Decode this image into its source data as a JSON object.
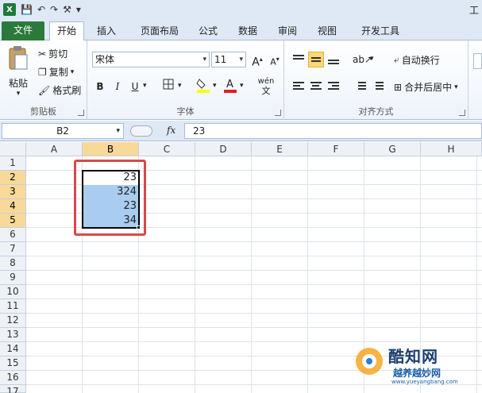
{
  "qat": {
    "app_icon": "X",
    "save": "💾",
    "undo": "↶",
    "redo": "↷",
    "tools": "⚒",
    "customize": "▾",
    "right_text": "工"
  },
  "tabs": [
    {
      "label": "文件",
      "kind": "file"
    },
    {
      "label": "开始",
      "kind": "active"
    },
    {
      "label": "插入",
      "kind": ""
    },
    {
      "label": "页面布局",
      "kind": ""
    },
    {
      "label": "公式",
      "kind": ""
    },
    {
      "label": "数据",
      "kind": ""
    },
    {
      "label": "审阅",
      "kind": ""
    },
    {
      "label": "视图",
      "kind": ""
    },
    {
      "label": "开发工具",
      "kind": ""
    }
  ],
  "clipboard": {
    "group_label": "剪贴板",
    "paste": "粘贴",
    "cut": "剪切",
    "copy": "复制",
    "format_painter": "格式刷"
  },
  "font": {
    "group_label": "字体",
    "font_name": "宋体",
    "font_size": "11",
    "grow": "A",
    "shrink": "A",
    "bold": "B",
    "italic": "I",
    "underline": "U",
    "wen": "wén"
  },
  "alignment": {
    "group_label": "对齐方式",
    "wrap_text": "自动换行",
    "merge_center": "合并后居中"
  },
  "formula_bar": {
    "name_box": "B2",
    "fx": "fx",
    "value": "23"
  },
  "columns": [
    "A",
    "B",
    "C",
    "D",
    "E",
    "F",
    "G",
    "H"
  ],
  "rows": [
    "1",
    "2",
    "3",
    "4",
    "5",
    "6",
    "7",
    "8",
    "9",
    "10",
    "11",
    "12",
    "13",
    "14",
    "15",
    "16",
    "17"
  ],
  "cells": {
    "B2": "23",
    "B3": "324",
    "B4": "23",
    "B5": "34"
  },
  "watermark": {
    "title": "酷知网",
    "subtitle": "越养越妙网",
    "url": "www.yueyangbang.com"
  },
  "colors": {
    "file_tab": "#2b7a3b",
    "selection_fill": "#a8cdf0",
    "highlight_border": "#d9484c",
    "header_active": "#f9d99a"
  }
}
